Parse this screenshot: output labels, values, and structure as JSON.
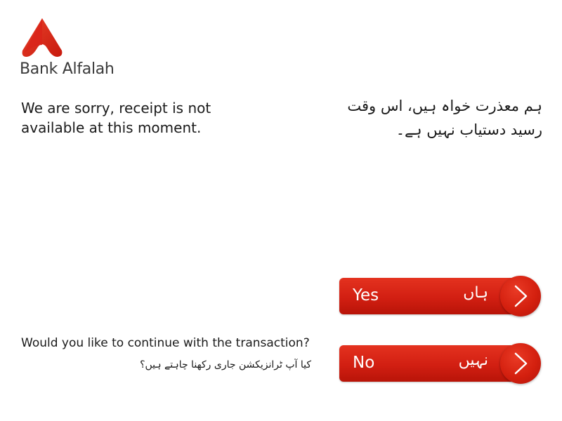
{
  "brand": {
    "name": "Bank Alfalah",
    "color": "#d9251a"
  },
  "message": {
    "english": "We are sorry, receipt is not available at this moment.",
    "urdu": "ہم معذرت خواہ ہیں، اس وقت رسید دستیاب نہیں ہے۔"
  },
  "question": {
    "english": "Would you like to continue with the transaction?",
    "urdu": "کیا آپ ٹرانزیکشن جاری رکھنا چاہتے ہیں؟"
  },
  "buttons": {
    "yes": {
      "label_en": "Yes",
      "label_ur": "ہاں",
      "icon": "chevron-right-icon"
    },
    "no": {
      "label_en": "No",
      "label_ur": "نہیں",
      "icon": "chevron-right-icon"
    }
  }
}
